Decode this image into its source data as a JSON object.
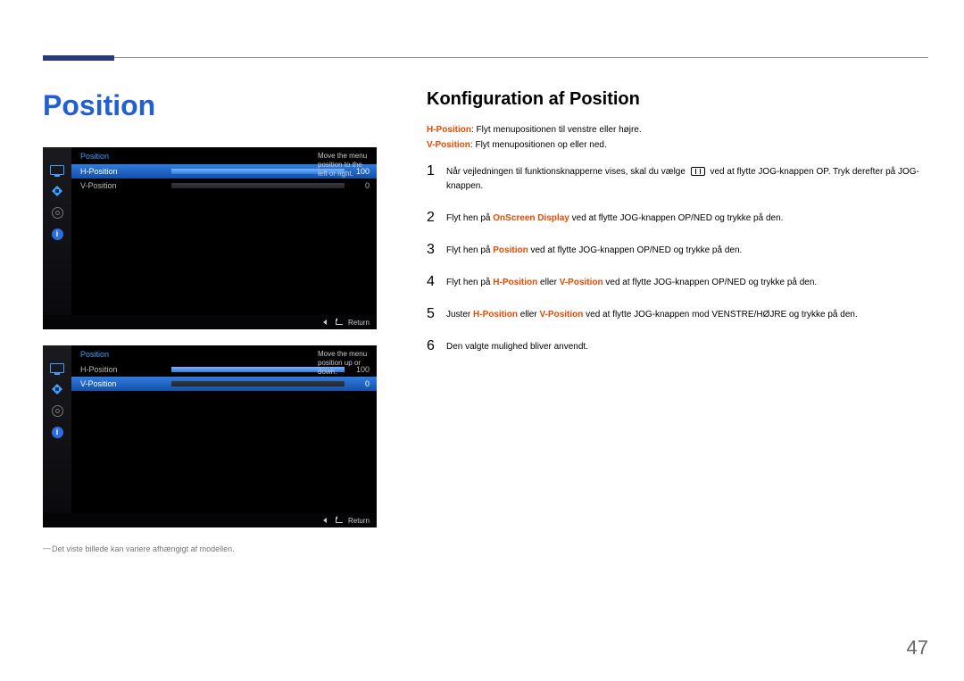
{
  "page_number": "47",
  "left": {
    "heading": "Position",
    "caption": "Det viste billede kan variere afhængigt af modellen.",
    "osd1": {
      "title": "Position",
      "tip": "Move the menu position to the left or right.",
      "h_label": "H-Position",
      "h_value": "100",
      "v_label": "V-Position",
      "v_value": "0",
      "return_label": "Return"
    },
    "osd2": {
      "title": "Position",
      "tip": "Move the menu position up or down.",
      "h_label": "H-Position",
      "h_value": "100",
      "v_label": "V-Position",
      "v_value": "0",
      "return_label": "Return"
    }
  },
  "right": {
    "heading": "Konfiguration af Position",
    "def_h_term": "H-Position",
    "def_h_text": ": Flyt menupositionen til venstre eller højre.",
    "def_v_term": "V-Position",
    "def_v_text": ": Flyt menupositionen op eller ned.",
    "steps": {
      "s1a": "Når vejledningen til funktionsknapperne vises, skal du vælge ",
      "s1b": " ved at flytte JOG-knappen OP. Tryk derefter på JOG-knappen.",
      "s2a": "Flyt hen på ",
      "s2kw": "OnScreen Display",
      "s2b": " ved at flytte JOG-knappen OP/NED og trykke på den.",
      "s3a": "Flyt hen på ",
      "s3kw": "Position",
      "s3b": " ved at flytte JOG-knappen OP/NED og trykke på den.",
      "s4a": "Flyt hen på ",
      "s4kw1": "H-Position",
      "s4mid": " eller ",
      "s4kw2": "V-Position",
      "s4b": " ved at flytte JOG-knappen OP/NED og trykke på den.",
      "s5a": "Juster ",
      "s5kw1": "H-Position",
      "s5mid": " eller ",
      "s5kw2": "V-Position",
      "s5b": " ved at flytte JOG-knappen mod VENSTRE/HØJRE og trykke på den.",
      "s6": "Den valgte mulighed bliver anvendt."
    },
    "nums": {
      "n1": "1",
      "n2": "2",
      "n3": "3",
      "n4": "4",
      "n5": "5",
      "n6": "6"
    }
  }
}
